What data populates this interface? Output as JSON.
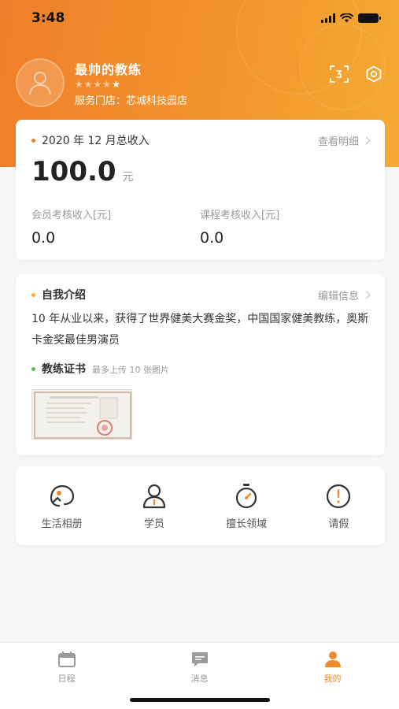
{
  "status_bar": {
    "time": "3:48"
  },
  "profile": {
    "name": "最帅的教练",
    "rating": 4,
    "rating_max": 5,
    "store_label": "服务门店：",
    "store_name": "芯城科技园店"
  },
  "header_actions": {
    "icons": [
      "scan-icon",
      "settings-icon"
    ]
  },
  "income": {
    "title": "2020 年 12 月总收入",
    "detail_link": "查看明细",
    "amount": "100.0",
    "unit": "元",
    "member_label": "会员考核收入[元]",
    "member_value": "0.0",
    "course_label": "课程考核收入[元]",
    "course_value": "0.0",
    "dot_color": "#f07e2a"
  },
  "intro": {
    "title": "自我介绍",
    "edit_link": "编辑信息",
    "text": "10 年从业以来，获得了世界健美大赛金奖，中国国家健美教练，奥斯卡金奖最佳男演员",
    "dot_color": "#f5b31e",
    "cert_title": "教练证书",
    "cert_hint": "最多上传 10 张图片",
    "cert_dot_color": "#5cb85c"
  },
  "shortcuts": [
    {
      "label": "生活相册",
      "icon": "album-icon"
    },
    {
      "label": "学员",
      "icon": "student-icon"
    },
    {
      "label": "擅长领域",
      "icon": "expertise-icon"
    },
    {
      "label": "请假",
      "icon": "leave-icon"
    }
  ],
  "tabbar": [
    {
      "label": "日程",
      "icon": "calendar-icon",
      "active": false
    },
    {
      "label": "消息",
      "icon": "message-icon",
      "active": false
    },
    {
      "label": "我的",
      "icon": "profile-icon",
      "active": true
    }
  ],
  "colors": {
    "accent": "#f08a2b",
    "header_start": "#f07e2a",
    "header_end": "#f4ab32"
  }
}
